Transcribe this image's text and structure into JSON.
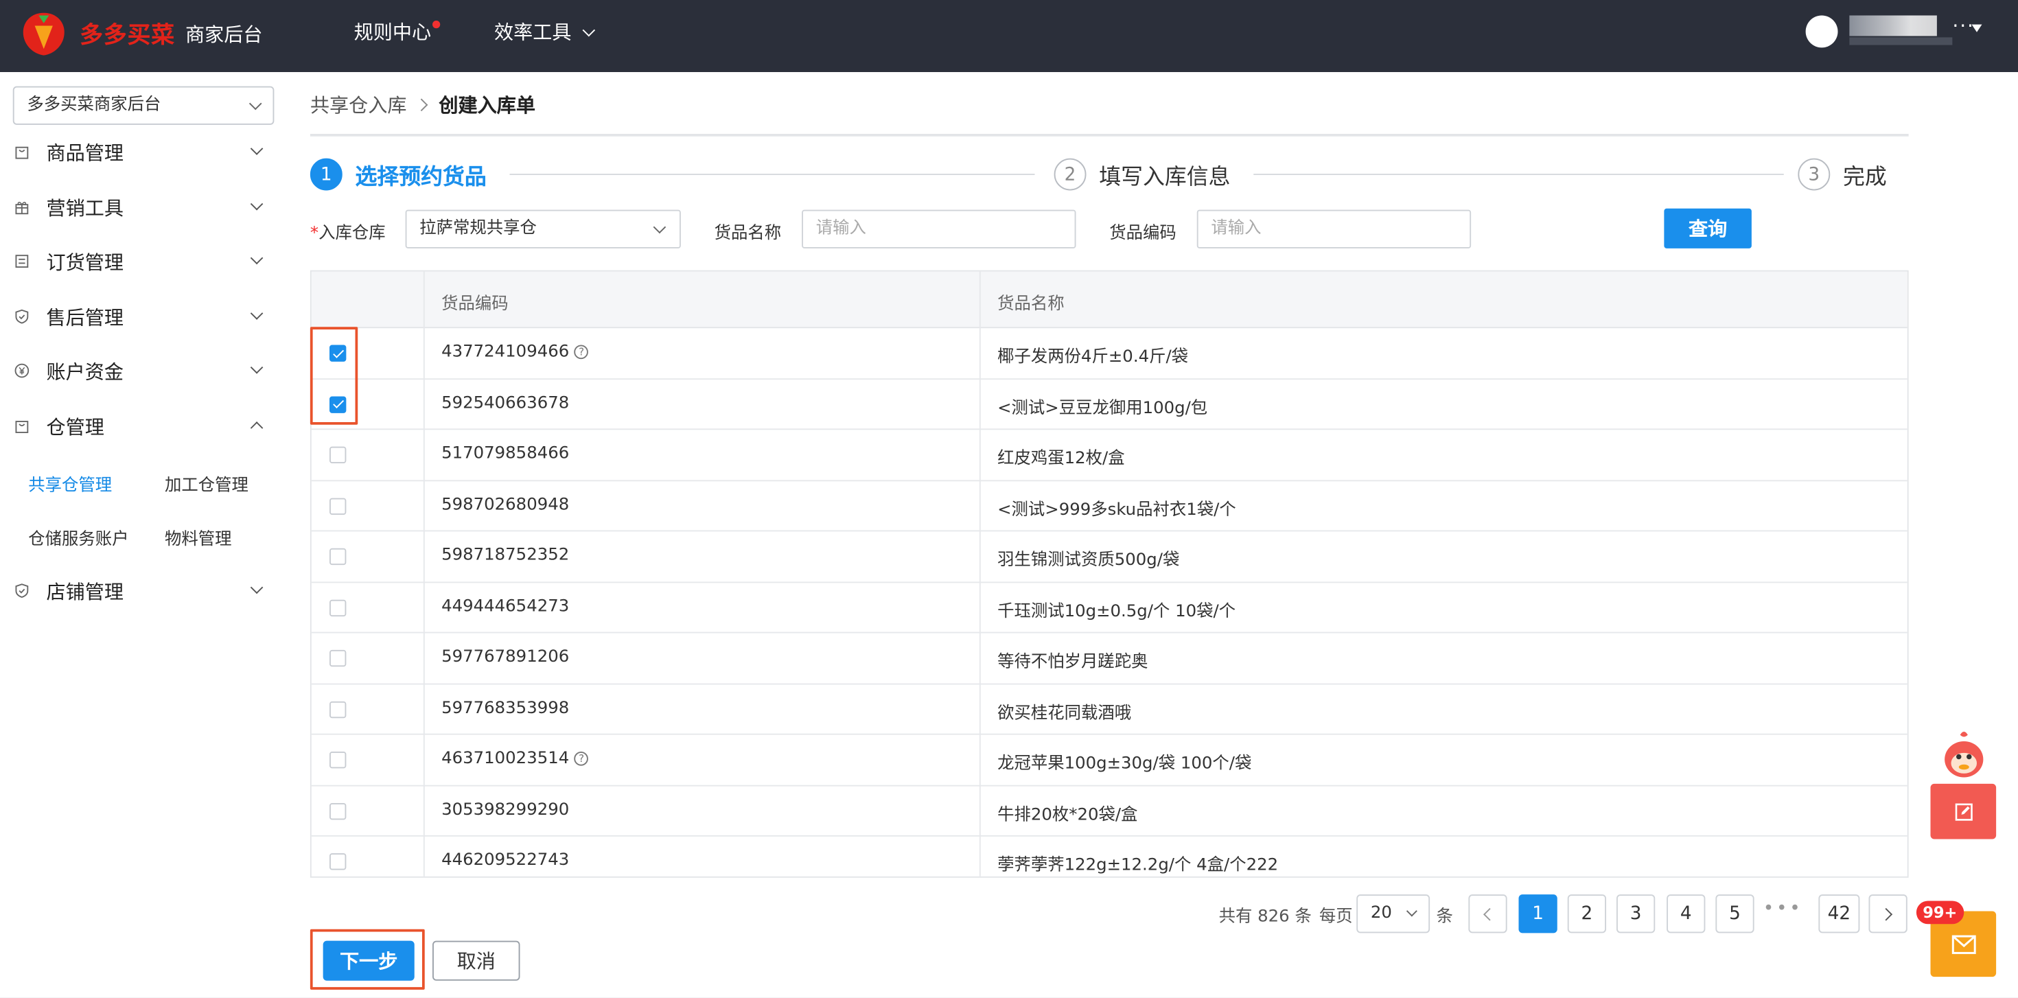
{
  "header": {
    "brand": "多多买菜",
    "brand_sub": "商家后台",
    "nav": [
      {
        "label": "规则中心"
      },
      {
        "label": "效率工具"
      }
    ],
    "user_more": "···"
  },
  "sidebar": {
    "shop_select": "多多买菜商家后台",
    "menu": [
      {
        "label": "商品管理"
      },
      {
        "label": "营销工具"
      },
      {
        "label": "订货管理"
      },
      {
        "label": "售后管理"
      },
      {
        "label": "账户资金"
      },
      {
        "label": "仓管理"
      },
      {
        "label": "店铺管理"
      }
    ],
    "sub_items": [
      {
        "label": "共享仓管理"
      },
      {
        "label": "加工仓管理"
      },
      {
        "label": "仓储服务账户"
      },
      {
        "label": "物料管理"
      }
    ]
  },
  "breadcrumb": {
    "parent": "共享仓入库",
    "current": "创建入库单"
  },
  "steps": [
    {
      "num": "1",
      "label": "选择预约货品",
      "state": "active"
    },
    {
      "num": "2",
      "label": "填写入库信息",
      "state": "pending"
    },
    {
      "num": "3",
      "label": "完成",
      "state": "pending"
    }
  ],
  "filters": {
    "warehouse_required": "*",
    "warehouse_label": "入库仓库",
    "warehouse_value": "拉萨常规共享仓",
    "name_label": "货品名称",
    "name_placeholder": "请输入",
    "code_label": "货品编码",
    "code_placeholder": "请输入",
    "query_label": "查询"
  },
  "table": {
    "headers": [
      "货品编码",
      "货品名称"
    ],
    "rows": [
      {
        "code": "437724109466",
        "name": "椰子发两份4斤±0.4斤/袋",
        "checked": true,
        "info": true
      },
      {
        "code": "592540663678",
        "name": "<测试>豆豆龙御用100g/包",
        "checked": true,
        "info": false
      },
      {
        "code": "517079858466",
        "name": "红皮鸡蛋12枚/盒",
        "checked": false,
        "info": false
      },
      {
        "code": "598702680948",
        "name": "<测试>999多sku品衬衣1袋/个",
        "checked": false,
        "info": false
      },
      {
        "code": "598718752352",
        "name": "羽生锦测试资质500g/袋",
        "checked": false,
        "info": false
      },
      {
        "code": "449444654273",
        "name": "千珏测试10g±0.5g/个 10袋/个",
        "checked": false,
        "info": false
      },
      {
        "code": "597767891206",
        "name": "等待不怕岁月蹉跎奥",
        "checked": false,
        "info": false
      },
      {
        "code": "597768353998",
        "name": "欲买桂花同载酒哦",
        "checked": false,
        "info": false
      },
      {
        "code": "463710023514",
        "name": "龙冠苹果100g±30g/袋 100个/袋",
        "checked": false,
        "info": true
      },
      {
        "code": "305398299290",
        "name": "牛排20枚*20袋/盒",
        "checked": false,
        "info": false
      },
      {
        "code": "446209522743",
        "name": "荸荠荸荠122g±12.2g/个 4盒/个222",
        "checked": false,
        "info": false
      }
    ]
  },
  "pagination": {
    "total_prefix": "共有",
    "total": "826",
    "total_suffix": "条",
    "per_page_label": "每页",
    "per_page": "20",
    "per_page_suffix": "条",
    "pages": [
      "1",
      "2",
      "3",
      "4",
      "5"
    ],
    "current_page": "1",
    "ellipsis": "•••",
    "last_page": "42"
  },
  "actions": {
    "next_label": "下一步",
    "cancel_label": "取消"
  },
  "floating": {
    "badge": "99+"
  },
  "colors": {
    "primary": "#1a8fec",
    "brand_red": "#e2231a",
    "topbar": "#2b2f3a",
    "highlight": "#e9532c",
    "mail_orange": "#f7a21b",
    "edit_red": "#f25a52"
  },
  "icons": [
    "logo-icon",
    "chevron-down-icon",
    "question-icon",
    "edit-icon",
    "mail-icon",
    "mascot-icon"
  ]
}
